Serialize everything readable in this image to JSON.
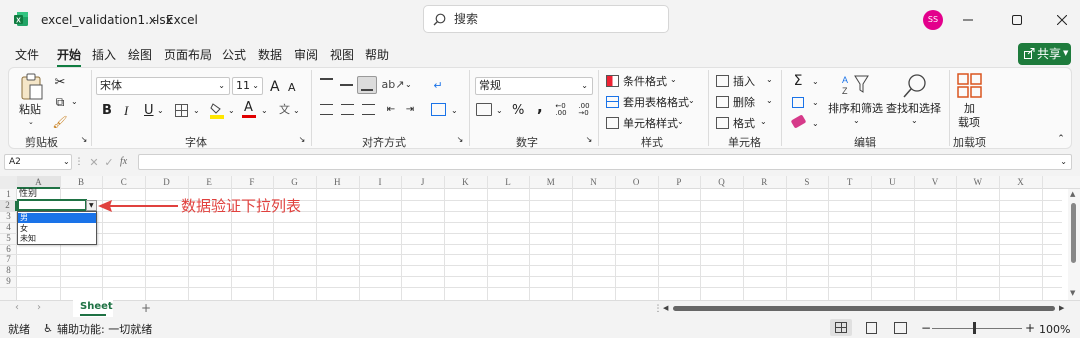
{
  "title": {
    "file": "excel_validation1.xlsx",
    "separator": "-",
    "app": "Excel",
    "search_placeholder": "搜索",
    "avatar_initials": "SS"
  },
  "menu": {
    "items": [
      "文件",
      "开始",
      "插入",
      "绘图",
      "页面布局",
      "公式",
      "数据",
      "审阅",
      "视图",
      "帮助"
    ],
    "active": "开始",
    "share": "共享"
  },
  "ribbon": {
    "clipboard": {
      "paste": "粘贴",
      "group": "剪贴板"
    },
    "font": {
      "name": "宋体",
      "size": "11",
      "group": "字体",
      "bold": "B",
      "italic": "I",
      "underline": "U",
      "font_color": "A",
      "grow": "A",
      "shrink": "A",
      "phonetic": "文"
    },
    "alignment": {
      "group": "对齐方式"
    },
    "number": {
      "format": "常规",
      "group": "数字",
      "percent": "%",
      "comma": ","
    },
    "styles": {
      "conditional": "条件格式",
      "table": "套用表格格式",
      "cell_styles": "单元格样式",
      "group": "样式"
    },
    "cells": {
      "insert": "插入",
      "delete": "删除",
      "format": "格式",
      "group": "单元格"
    },
    "editing": {
      "sort_filter": "排序和筛选",
      "find_select": "查找和选择",
      "group": "编辑"
    },
    "addins": {
      "label1": "加",
      "label2": "载项",
      "group": "加载项"
    }
  },
  "formula_bar": {
    "name_box": "A2",
    "fx": "fx",
    "value": ""
  },
  "grid": {
    "columns": [
      "A",
      "B",
      "C",
      "D",
      "E",
      "F",
      "G",
      "H",
      "I",
      "J",
      "K",
      "L",
      "M",
      "N",
      "O",
      "P",
      "Q",
      "R",
      "S",
      "T",
      "U",
      "V",
      "W",
      "X"
    ],
    "rows": [
      "1",
      "2",
      "3",
      "4",
      "5",
      "6",
      "7",
      "8",
      "9"
    ],
    "cells": {
      "A1": "性别"
    },
    "dropdown_options": [
      "男",
      "女",
      "未知"
    ],
    "selected_option": "男"
  },
  "annotation": {
    "text": "数据验证下拉列表",
    "color": "#e0413e"
  },
  "sheet_tabs": {
    "tabs": [
      "Sheet"
    ],
    "add": "+"
  },
  "status": {
    "ready": "就绪",
    "accessibility": "辅助功能: 一切就绪",
    "zoom": "100%"
  },
  "colors": {
    "accent": "#107c41",
    "share_bg": "#1e7b3c",
    "avatar": "#e3008c",
    "annotation": "#e0413e",
    "selection": "#1a73e8"
  }
}
